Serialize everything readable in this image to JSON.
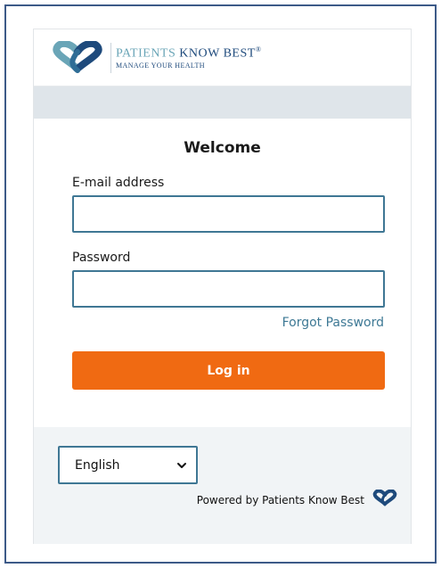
{
  "brand": {
    "name_part1": "PATIENTS ",
    "name_part2": "KNOW BEST",
    "registered": "®",
    "tagline": "MANAGE YOUR HEALTH",
    "logo_icon": "pkb-heart-logo-icon",
    "colors": {
      "navy": "#1e4a7c",
      "teal": "#6aa5b7"
    }
  },
  "form": {
    "title": "Welcome",
    "email_label": "E-mail address",
    "email_value": "",
    "password_label": "Password",
    "password_value": "",
    "forgot_link": "Forgot Password",
    "login_button": "Log in",
    "accent_color": "#f06a12"
  },
  "footer": {
    "language_selected": "English",
    "language_icon": "chevron-down-icon",
    "powered_by": "Powered by Patients Know Best",
    "powered_icon": "pkb-heart-logo-icon"
  }
}
